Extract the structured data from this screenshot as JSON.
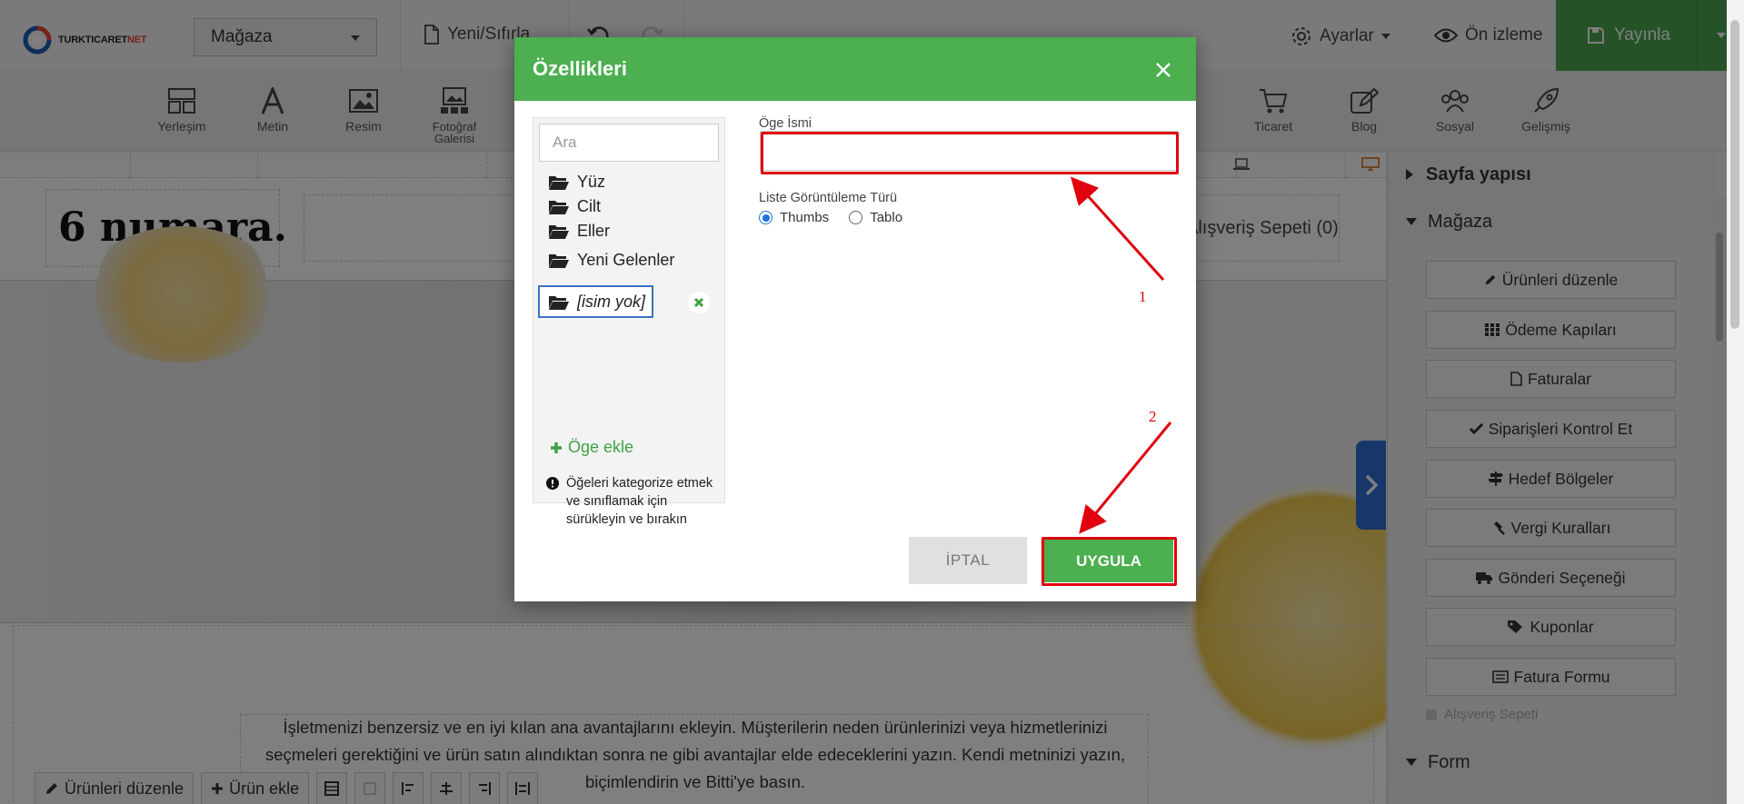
{
  "topbar": {
    "logo_text": "TURKTICARET",
    "logo_suffix": "NET",
    "store_select": "Mağaza",
    "new_reset": "Yeni/Sıfırla",
    "settings": "Ayarlar",
    "preview": "Ön izleme",
    "publish": "Yayınla"
  },
  "toolbar": {
    "items": [
      {
        "label": "Yerleşim",
        "icon": "layout-icon"
      },
      {
        "label": "Metin",
        "icon": "text-icon"
      },
      {
        "label": "Resim",
        "icon": "image-icon"
      },
      {
        "label": "Fotoğraf Galerisi",
        "icon": "gallery-icon"
      },
      {
        "label": "Ticaret",
        "icon": "cart-icon"
      },
      {
        "label": "Blog",
        "icon": "blog-icon"
      },
      {
        "label": "Sosyal",
        "icon": "social-icon"
      },
      {
        "label": "Gelişmiş",
        "icon": "rocket-icon"
      }
    ]
  },
  "canvas": {
    "brand": "6 numara.",
    "cart": "Alışveriş Sepeti (0)",
    "body_text": "İşletmenizi benzersiz ve en iyi kılan ana avantajlarını ekleyin. Müşterilerin neden ürünlerinizi veya hizmetlerinizi seçmeleri gerektiğini ve ürün satın alındıktan sonra ne gibi avantajlar elde edeceklerini yazın. Kendi metninizi yazın, biçimlendirin ve Bitti'ye basın.",
    "bottom": {
      "edit_products": "Ürünleri düzenle",
      "add_product": "Ürün ekle"
    }
  },
  "right_panel": {
    "page_structure": "Sayfa yapısı",
    "store": "Mağaza",
    "buttons": [
      "Ürünleri düzenle",
      "Ödeme Kapıları",
      "Faturalar",
      "Siparişleri Kontrol Et",
      "Hedef Bölgeler",
      "Vergi Kuralları",
      "Gönderi Seçeneği",
      "Kuponlar",
      "Fatura Formu"
    ],
    "cart_checkbox": "Alışveriş Sepeti",
    "form": "Form"
  },
  "modal": {
    "title": "Özellikleri",
    "search_placeholder": "Ara",
    "folders": [
      "Yüz",
      "Cilt",
      "Eller",
      "Yeni Gelenler"
    ],
    "selected_folder": "[isim yok]",
    "add_item": "Öge ekle",
    "hint": "Öğeleri kategorize etmek ve sınıflamak için sürükleyin ve bırakın",
    "name_label": "Öge İsmi",
    "name_value": "",
    "list_type_label": "Liste Görüntüleme Türü",
    "options": [
      "Thumbs",
      "Tablo"
    ],
    "selected_option": "Thumbs",
    "cancel": "İPTAL",
    "apply": "UYGULA"
  },
  "annotations": {
    "arrow1": "1",
    "arrow2": "2",
    "color": "#e0000f"
  }
}
